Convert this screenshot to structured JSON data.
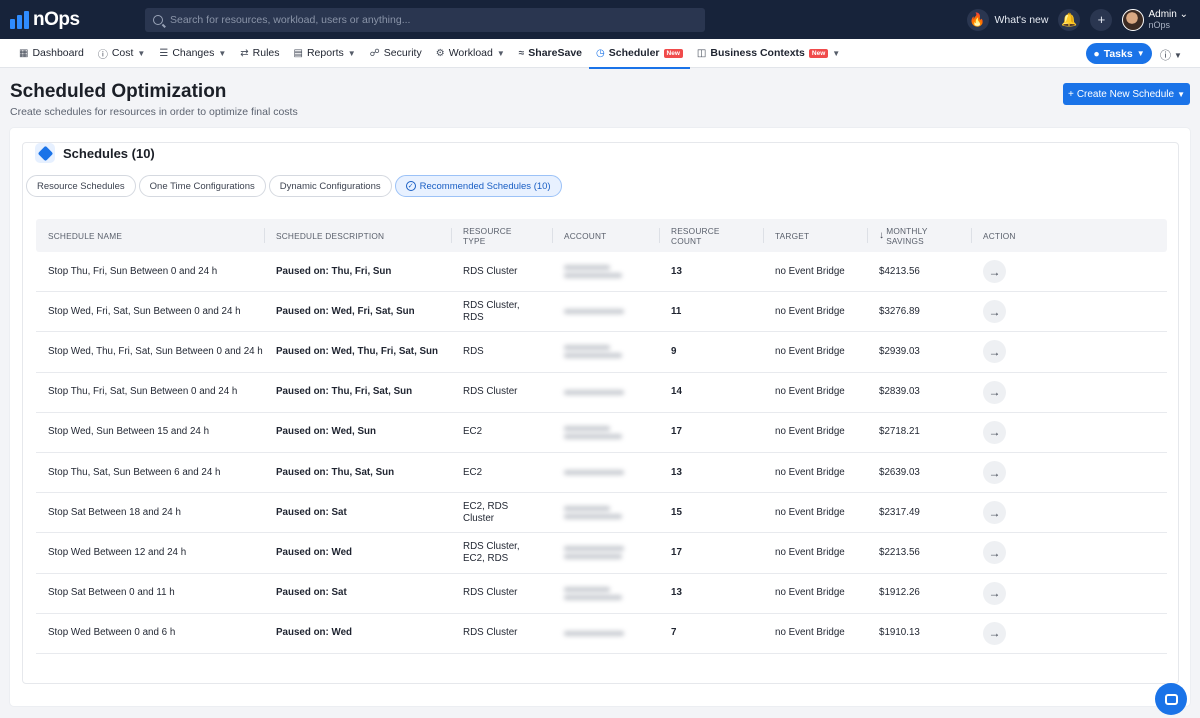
{
  "app": {
    "logo_text": "nOps"
  },
  "topbar": {
    "search_placeholder": "Search for resources, workload, users or anything...",
    "whats_new": "What's new",
    "user_name": "Admin",
    "user_org": "nOps"
  },
  "nav": {
    "items": [
      {
        "label": "Dashboard",
        "icon": "grid-icon",
        "chevron": false
      },
      {
        "label": "Cost",
        "icon": "dollar-icon",
        "chevron": true
      },
      {
        "label": "Changes",
        "icon": "list-icon",
        "chevron": true
      },
      {
        "label": "Rules",
        "icon": "shuffle-icon",
        "chevron": false
      },
      {
        "label": "Reports",
        "icon": "document-icon",
        "chevron": true
      },
      {
        "label": "Security",
        "icon": "lock-icon",
        "chevron": false
      },
      {
        "label": "Workload",
        "icon": "gear-icon",
        "chevron": true
      },
      {
        "label": "ShareSave",
        "icon": "sharesave-icon",
        "chevron": false
      },
      {
        "label": "Scheduler",
        "icon": "clock-icon",
        "chevron": false,
        "badge": "New",
        "active": true
      },
      {
        "label": "Business Contexts",
        "icon": "briefcase-icon",
        "chevron": true,
        "badge": "New"
      }
    ],
    "tasks_label": "Tasks"
  },
  "header": {
    "title": "Scheduled Optimization",
    "subtitle": "Create schedules for resources in order to optimize final costs",
    "create_button": "Create New Schedule"
  },
  "schedules": {
    "title": "Schedules (10)",
    "tabs": [
      {
        "label": "Resource Schedules"
      },
      {
        "label": "One Time Configurations"
      },
      {
        "label": "Dynamic Configurations"
      },
      {
        "label": "Recommended Schedules (10)",
        "active": true
      }
    ],
    "columns": [
      "Schedule Name",
      "Schedule Description",
      "Resource Type",
      "Account",
      "Resource Count",
      "Target",
      "Monthly Savings",
      "Action"
    ],
    "rows": [
      {
        "name": "Stop Thu, Fri, Sun Between 0 and 24 h",
        "description": "Paused on: Thu, Fri, Sun",
        "resource_type": "RDS Cluster",
        "count": "13",
        "target": "no Event Bridge",
        "savings": "$4213.56"
      },
      {
        "name": "Stop Wed, Fri, Sat, Sun Between 0 and 24 h",
        "description": "Paused on: Wed, Fri, Sat, Sun",
        "resource_type": "RDS Cluster, RDS",
        "count": "11",
        "target": "no Event Bridge",
        "savings": "$3276.89"
      },
      {
        "name": "Stop Wed, Thu, Fri, Sat, Sun Between 0 and 24 h",
        "description": "Paused on: Wed, Thu, Fri, Sat, Sun",
        "resource_type": "RDS",
        "count": "9",
        "target": "no Event Bridge",
        "savings": "$2939.03"
      },
      {
        "name": "Stop Thu, Fri, Sat, Sun Between 0 and 24 h",
        "description": "Paused on: Thu, Fri, Sat, Sun",
        "resource_type": "RDS Cluster",
        "count": "14",
        "target": "no Event Bridge",
        "savings": "$2839.03"
      },
      {
        "name": "Stop Wed, Sun Between 15 and 24 h",
        "description": "Paused on: Wed, Sun",
        "resource_type": "EC2",
        "count": "17",
        "target": "no Event Bridge",
        "savings": "$2718.21"
      },
      {
        "name": "Stop Thu, Sat, Sun Between 6 and 24 h",
        "description": "Paused on: Thu, Sat, Sun",
        "resource_type": "EC2",
        "count": "13",
        "target": "no Event Bridge",
        "savings": "$2639.03"
      },
      {
        "name": "Stop Sat Between 18 and 24 h",
        "description": "Paused on: Sat",
        "resource_type": "EC2, RDS Cluster",
        "count": "15",
        "target": "no Event Bridge",
        "savings": "$2317.49"
      },
      {
        "name": "Stop Wed Between 12 and 24 h",
        "description": "Paused on: Wed",
        "resource_type": "RDS Cluster, EC2, RDS",
        "count": "17",
        "target": "no Event Bridge",
        "savings": "$2213.56"
      },
      {
        "name": "Stop Sat Between 0 and 11 h",
        "description": "Paused on: Sat",
        "resource_type": "RDS Cluster",
        "count": "13",
        "target": "no Event Bridge",
        "savings": "$1912.26"
      },
      {
        "name": "Stop Wed Between 0 and 6 h",
        "description": "Paused on: Wed",
        "resource_type": "RDS Cluster",
        "count": "7",
        "target": "no Event Bridge",
        "savings": "$1910.13"
      }
    ]
  },
  "colors": {
    "primary": "#1a73e8",
    "topbar": "#17233a",
    "badge": "#f04b4b"
  }
}
